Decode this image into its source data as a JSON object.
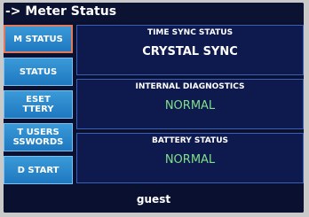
{
  "title": "-> Meter Status",
  "nav": {
    "buttons": [
      {
        "line1": "M STATUS",
        "line2": ""
      },
      {
        "line1": "STATUS",
        "line2": ""
      },
      {
        "line1": "ESET",
        "line2": "TTERY"
      },
      {
        "line1": "T USERS",
        "line2": "SSWORDS"
      },
      {
        "line1": "D START",
        "line2": ""
      }
    ]
  },
  "panels": {
    "time_sync": {
      "label": "TIME SYNC STATUS",
      "value": "CRYSTAL SYNC"
    },
    "internal_diagnostics": {
      "label": "INTERNAL DIAGNOSTICS",
      "value": "NORMAL"
    },
    "battery": {
      "label": "BATTERY STATUS",
      "value": "NORMAL"
    }
  },
  "footer": {
    "user": "guest"
  },
  "colors": {
    "screen_bg": "#0a1030",
    "panel_bg": "#0e1a4e",
    "panel_border": "#3a5fb8",
    "nav_button": "#1f78c0",
    "active_border": "#e07a5a",
    "status_ok": "#7fe08a"
  }
}
